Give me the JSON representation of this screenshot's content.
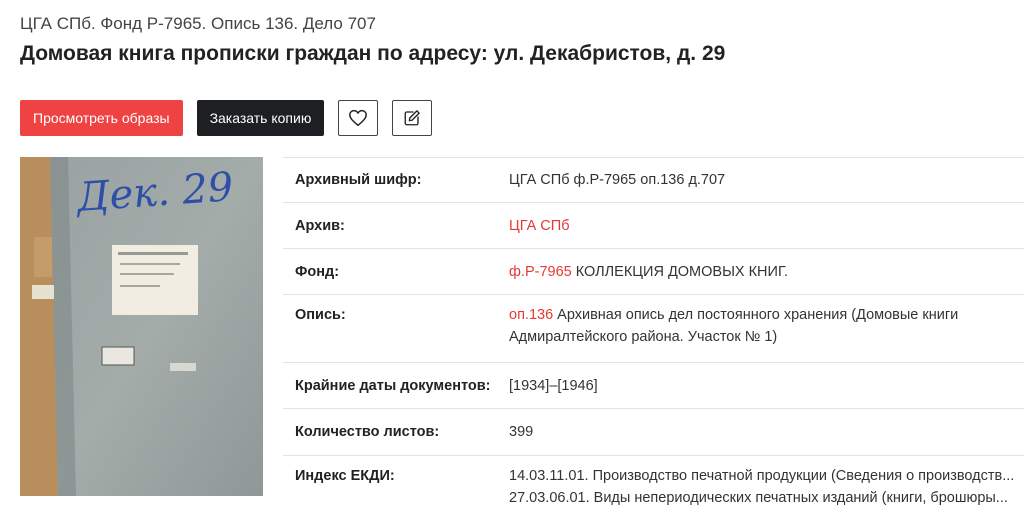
{
  "breadcrumb": "ЦГА СПб. Фонд Р-7965. Опись 136. Дело 707",
  "title": "Домовая книга прописки граждан по адресу: ул. Декабристов, д. 29",
  "actions": {
    "view_images": "Просмотреть образы",
    "order_copy": "Заказать копию",
    "favorite_icon": "heart-icon",
    "edit_icon": "edit-icon"
  },
  "cover": {
    "handwriting": "Дек. 29"
  },
  "details": {
    "cipher": {
      "label": "Архивный шифр:",
      "value": "ЦГА СПб ф.Р-7965 оп.136 д.707"
    },
    "archive": {
      "label": "Архив:",
      "link": "ЦГА СПб"
    },
    "fond": {
      "label": "Фонд:",
      "link": "ф.Р-7965",
      "text": "КОЛЛЕКЦИЯ ДОМОВЫХ КНИГ."
    },
    "inventory": {
      "label": "Опись:",
      "link": "оп.136",
      "line1": "Архивная опись дел постоянного хранения (Домовые книги",
      "line2": "Адмиралтейского района. Участок № 1)"
    },
    "dates": {
      "label": "Крайние даты документов:",
      "value": "[1934]–[1946]"
    },
    "sheets": {
      "label": "Количество листов:",
      "value": "399"
    },
    "ekdi": {
      "label": "Индекс ЕКДИ:",
      "line1": "14.03.11.01. Производство печатной продукции (Сведения о производств...",
      "line2": "27.03.06.01. Виды непериодических печатных изданий (книги, брошюры..."
    }
  },
  "colors": {
    "accent": "#ef4343",
    "dark_button": "#1e1f23",
    "link": "#e53935"
  }
}
